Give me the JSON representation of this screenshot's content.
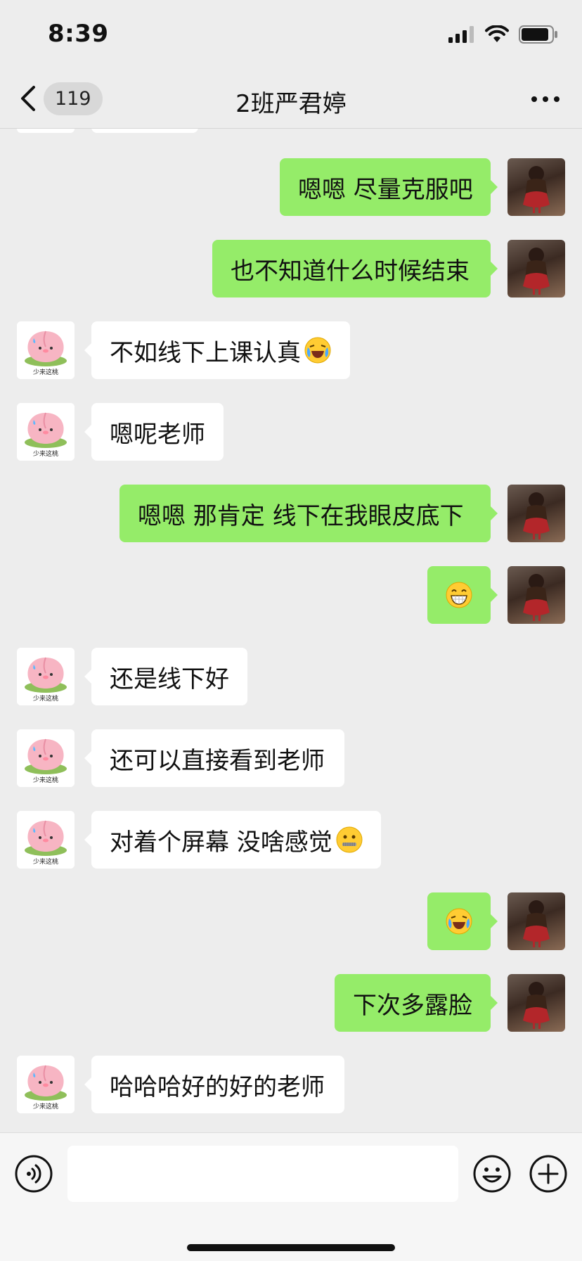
{
  "status_bar": {
    "time": "8:39"
  },
  "nav": {
    "unread_count": "119",
    "title": "2班严君婷"
  },
  "messages": [
    {
      "side": "out",
      "text": "嗯嗯 尽量克服吧"
    },
    {
      "side": "out",
      "text": "也不知道什么时候结束"
    },
    {
      "side": "in",
      "text": "不如线下上课认真",
      "emoji": "laughing-crying"
    },
    {
      "side": "in",
      "text": "嗯呢老师"
    },
    {
      "side": "out",
      "text": "嗯嗯 那肯定 线下在我眼皮底下"
    },
    {
      "side": "out",
      "text": "",
      "emoji": "grin"
    },
    {
      "side": "in",
      "text": "还是线下好"
    },
    {
      "side": "in",
      "text": "还可以直接看到老师"
    },
    {
      "side": "in",
      "text": "对着个屏幕 没啥感觉",
      "emoji": "zipper-mouth"
    },
    {
      "side": "out",
      "text": "",
      "emoji": "laughing-crying"
    },
    {
      "side": "out",
      "text": "下次多露脸"
    },
    {
      "side": "in",
      "text": "哈哈哈好的好的老师"
    }
  ],
  "contact_avatar": {
    "caption": "少来这桃",
    "icon": "peach-avatar-icon"
  },
  "self_avatar": {
    "icon": "figure-photo-avatar"
  },
  "input_bar": {
    "placeholder": ""
  },
  "colors": {
    "out_bubble": "#95ec69",
    "in_bubble": "#ffffff",
    "background": "#ededed"
  }
}
